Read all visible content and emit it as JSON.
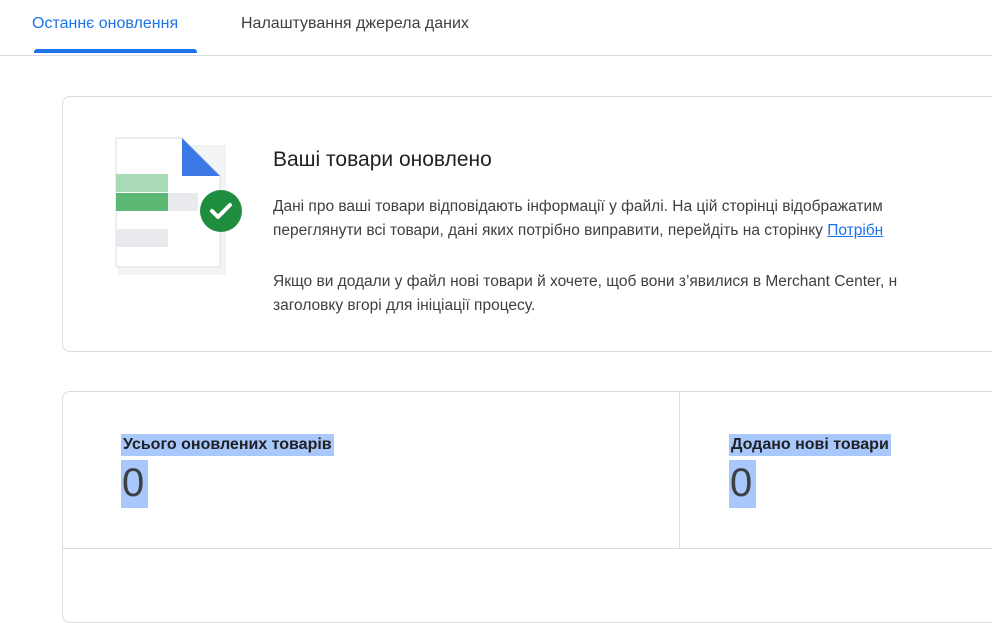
{
  "tabs": [
    {
      "label": "Останнє оновлення",
      "active": true
    },
    {
      "label": "Налаштування джерела даних",
      "active": false
    }
  ],
  "status_card": {
    "title": "Ваші товари оновлено",
    "paragraph1_line1": "Дані про ваші товари відповідають інформації у файлі. На цій сторінці відображатим",
    "paragraph1_line2_prefix": "переглянути всі товари, дані яких потрібно виправити, перейдіть на сторінку ",
    "paragraph1_link": "Потрібн",
    "paragraph2_line1": "Якщо ви додали у файл нові товари й хочете, щоб вони з’явилися в Merchant Center, н",
    "paragraph2_line2": "заголовку вгорі для ініціації процесу."
  },
  "stats": [
    {
      "label": "Усього оновлених товарів",
      "value": "0"
    },
    {
      "label": "Додано нові товари",
      "value": "0"
    }
  ],
  "colors": {
    "accent": "#1a73e8",
    "success": "#1e8e3e",
    "sheet_green": "#5bb974",
    "selection": "#a8c7fa"
  },
  "icons": {
    "illustration": "spreadsheet-file-checkmark-icon"
  }
}
